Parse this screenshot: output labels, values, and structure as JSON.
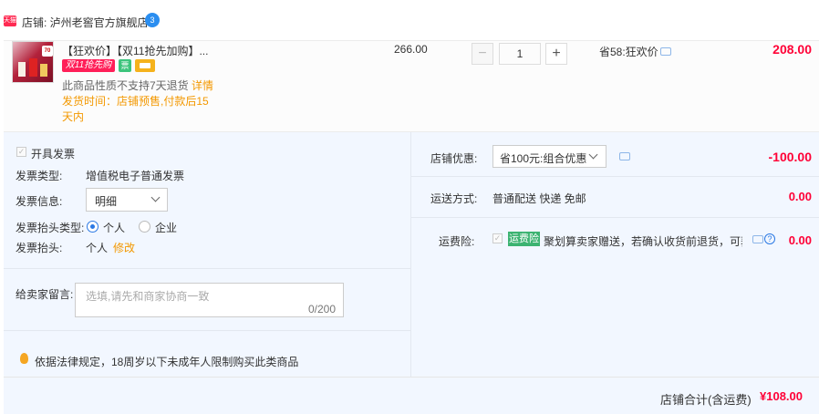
{
  "shop": {
    "tag": "天猫",
    "label": "店铺: 泸州老窖官方旗舰店",
    "chat_badge": "3"
  },
  "product": {
    "title": "【狂欢价】【双11抢先加购】...",
    "promo_tag": "双11抢先购",
    "icon_tag1": "票",
    "no_return": "此商品性质不支持7天退货",
    "detail_link": "详情",
    "ship_time": "发货时间：店铺预售,付款后15天内",
    "unit_price": "266.00",
    "quantity": "1",
    "qty_minus": "−",
    "qty_plus": "+",
    "save_text": "省58:狂欢价",
    "total": "208.00",
    "image_badge": "70"
  },
  "invoice": {
    "checkbox_mark": "✓",
    "title": "开具发票",
    "type_label": "发票类型:",
    "type_value": "增值税电子普通发票",
    "info_label": "发票信息:",
    "info_value": "明细",
    "header_type_label": "发票抬头类型:",
    "header_type_options": [
      "个人",
      "企业"
    ],
    "header_label": "发票抬头:",
    "header_value": "个人",
    "edit_link": "修改"
  },
  "message": {
    "label": "给卖家留言:",
    "placeholder": "选填,请先和商家协商一致",
    "counter": "0/200"
  },
  "tip": {
    "text": "依据法律规定，18周岁以下未成年人限制购买此类商品"
  },
  "discount": {
    "label": "店铺优惠:",
    "value": "省100元:组合优惠",
    "amount": "-100.00"
  },
  "shipping": {
    "label": "运送方式:",
    "value": "普通配送 快递 免邮",
    "amount": "0.00"
  },
  "insurance": {
    "label": "运费险:",
    "checkbox_mark": "✓",
    "tag": "运费险",
    "text": "聚划算卖家赠送，若确认收货前退货，可获...",
    "help": "?",
    "amount": "0.00"
  },
  "footer": {
    "label": "店铺合计(含运费)",
    "total": "¥108.00"
  },
  "colors": {
    "accent_red": "#ff0036",
    "orange_link": "#f39800",
    "blue": "#2b79e4",
    "panel_bg": "#f2f7ff"
  }
}
